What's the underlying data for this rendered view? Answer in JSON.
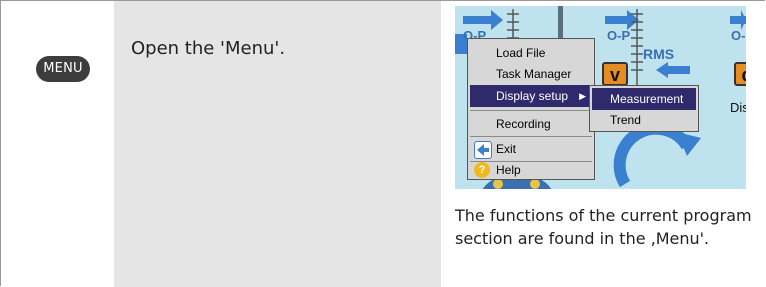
{
  "step": {
    "key_label": "MENU",
    "instruction": "Open the 'Menu'."
  },
  "screenshot": {
    "background_labels": {
      "op_1": "O-P",
      "op_2": "O-P",
      "op_3": "O-",
      "rms": "RMS",
      "tile_v": "v",
      "tile_d": "d",
      "disp": "Disp"
    },
    "menu": {
      "items": [
        {
          "label": "Load File"
        },
        {
          "label": "Task Manager"
        },
        {
          "label": "Display setup",
          "selected": true,
          "has_submenu": true
        },
        {
          "label": "Recording"
        },
        {
          "label": "Exit",
          "icon": "exit-icon"
        },
        {
          "label": "Help",
          "icon": "help-icon"
        }
      ],
      "submenu": [
        {
          "label": "Measurement",
          "selected": true
        },
        {
          "label": "Trend"
        }
      ]
    },
    "colors": {
      "background": "#bfe3ee",
      "selection": "#2f2a6b",
      "menu_bg": "#d7d7d7",
      "arrow_blue": "#3a7fd0",
      "tile_orange": "#e58c22"
    }
  },
  "caption": {
    "text": "The functions of the current program section are found in the ‚Menu'."
  }
}
